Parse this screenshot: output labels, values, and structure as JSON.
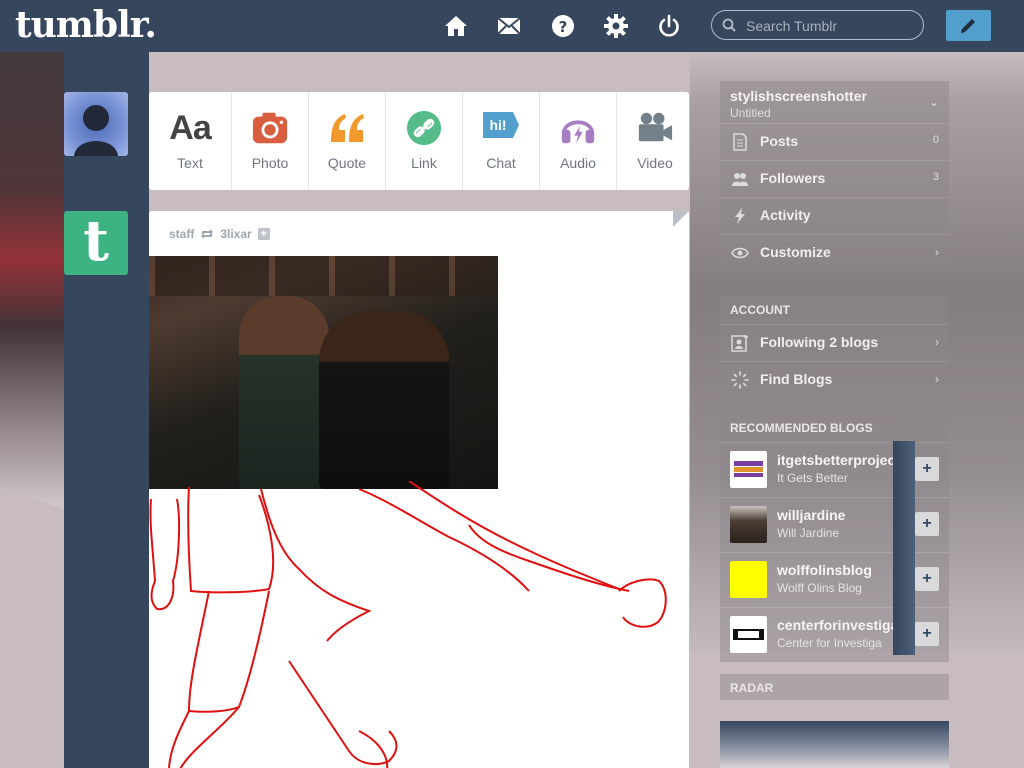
{
  "topbar": {
    "logo": "tumblr.",
    "search_placeholder": "Search Tumblr",
    "nav": [
      "home-icon",
      "mail-icon",
      "help-icon",
      "gear-icon",
      "power-icon"
    ],
    "compose": "pencil-icon"
  },
  "post_types": [
    {
      "label": "Text",
      "glyph": "Aa",
      "color": "#444444"
    },
    {
      "label": "Photo",
      "glyph": "camera",
      "color": "#d95e40"
    },
    {
      "label": "Quote",
      "glyph": "quote",
      "color": "#f2992e"
    },
    {
      "label": "Link",
      "glyph": "link",
      "color": "#56bc8a"
    },
    {
      "label": "Chat",
      "glyph": "hi!",
      "color": "#529ecc"
    },
    {
      "label": "Audio",
      "glyph": "headphones",
      "color": "#a77dc2"
    },
    {
      "label": "Video",
      "glyph": "camera-video",
      "color": "#748089"
    }
  ],
  "post": {
    "author": "staff",
    "reblogged_from": "3lixar"
  },
  "sidebar": {
    "blog_name": "stylishscreenshotter",
    "blog_title": "Untitled",
    "items": [
      {
        "label": "Posts",
        "count": "0"
      },
      {
        "label": "Followers",
        "count": "3"
      },
      {
        "label": "Activity",
        "count": ""
      },
      {
        "label": "Customize",
        "count": ""
      }
    ],
    "account_heading": "ACCOUNT",
    "account_items": [
      {
        "label": "Following 2 blogs"
      },
      {
        "label": "Find Blogs"
      }
    ],
    "recommended_heading": "RECOMMENDED BLOGS",
    "recommended": [
      {
        "name": "itgetsbetterproject",
        "title": "It Gets Better",
        "thumb_color": "#ffffff"
      },
      {
        "name": "willjardine",
        "title": "Will Jardine",
        "thumb_color": "#4a3d34"
      },
      {
        "name": "wolffolinsblog",
        "title": "Wolff Olins Blog",
        "thumb_color": "#ffff00"
      },
      {
        "name": "centerforinvestigat",
        "title": "Center for Investiga",
        "thumb_color": "#ffffff"
      }
    ],
    "radar_heading": "RADAR"
  }
}
